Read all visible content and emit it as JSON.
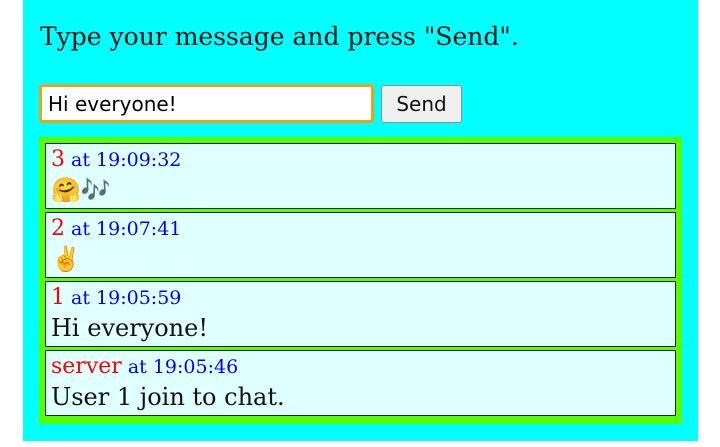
{
  "instruction": "Type your message and press \"Send\".",
  "input": {
    "value": "Hi everyone!",
    "placeholder": ""
  },
  "send_label": "Send",
  "time_prefix": " at ",
  "messages": [
    {
      "sender": "3",
      "time": "19:09:32",
      "text": "🤗🎶"
    },
    {
      "sender": "2",
      "time": "19:07:41",
      "text": "✌️"
    },
    {
      "sender": "1",
      "time": "19:05:59",
      "text": "Hi everyone!"
    },
    {
      "sender": "server",
      "time": "19:05:46",
      "text": "User 1 join to chat."
    }
  ],
  "colors": {
    "page_background": "#00ffff",
    "log_background": "#55ff00",
    "message_background": "#e0ffff",
    "sender": "#ff0000",
    "time": "#0000ff",
    "input_focus_border": "#e8a317"
  }
}
